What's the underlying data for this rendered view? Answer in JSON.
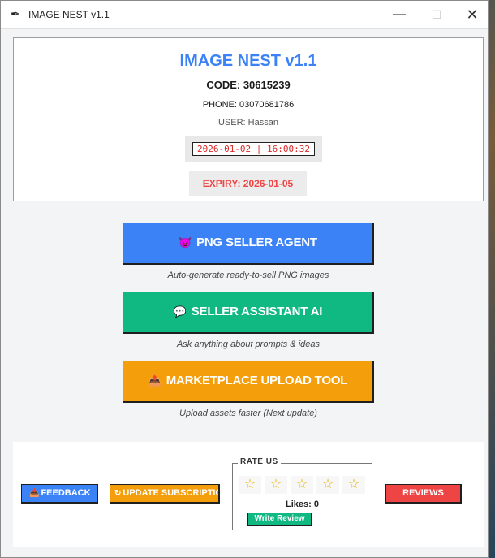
{
  "window": {
    "title": "IMAGE NEST v1.1",
    "controls": {
      "minimize": "—",
      "maximize": "☐",
      "close": "✕"
    }
  },
  "header": {
    "app_title": "IMAGE NEST v1.1",
    "code": "CODE: 30615239",
    "phone": "PHONE: 03070681786",
    "user": "USER: Hassan",
    "datetime": "2026-01-02 | 16:00:32",
    "expiry": "EXPIRY: 2026-01-05"
  },
  "tools": [
    {
      "label": "PNG SELLER AGENT",
      "icon": "robot-icon",
      "caption": "Auto-generate ready-to-sell PNG images",
      "color": "#3b82f6"
    },
    {
      "label": "SELLER ASSISTANT AI",
      "icon": "chat-icon",
      "caption": "Ask anything about prompts & ideas",
      "color": "#10b981"
    },
    {
      "label": "MARKETPLACE UPLOAD TOOL",
      "icon": "upload-icon",
      "caption": "Upload assets faster (Next update)",
      "color": "#f59e0b"
    }
  ],
  "footer": {
    "feedback_label": "FEEDBACK",
    "update_label": "UPDATE SUBSCRIPTION",
    "reviews_label": "REVIEWS",
    "rate": {
      "title": "RATE US",
      "stars": [
        "☆",
        "☆",
        "☆",
        "☆",
        "☆"
      ],
      "likes": "Likes: 0",
      "write_review_label": "Write Review"
    }
  },
  "colors": {
    "accent_blue": "#3b82f6",
    "accent_green": "#10b981",
    "accent_orange": "#f59e0b",
    "accent_red": "#ef4444"
  }
}
